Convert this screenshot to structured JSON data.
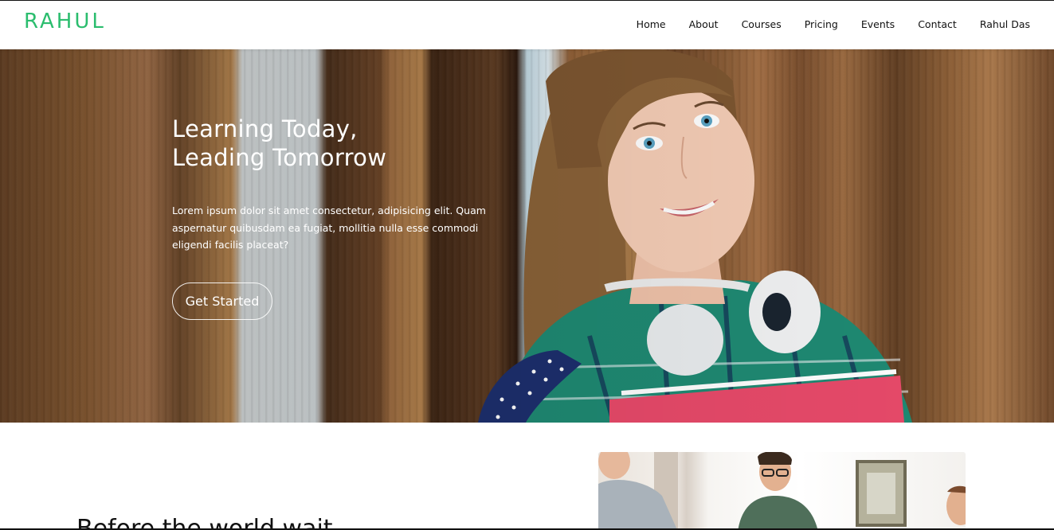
{
  "header": {
    "logo": "RAHUL",
    "nav": [
      "Home",
      "About",
      "Courses",
      "Pricing",
      "Events",
      "Contact",
      "Rahul Das"
    ]
  },
  "hero": {
    "title_line1": "Learning Today,",
    "title_line2": "Leading Tomorrow",
    "description": "Lorem ipsum dolor sit amet consectetur, adipisicing elit. Quam aspernatur quibusdam ea fugiat, mollitia nulla esse commodi eligendi facilis placeat?",
    "cta_label": "Get Started"
  },
  "section": {
    "heading_partial": "Before the world wait"
  },
  "colors": {
    "brand": "#2bbd6e",
    "hero_text": "#ffffff"
  }
}
